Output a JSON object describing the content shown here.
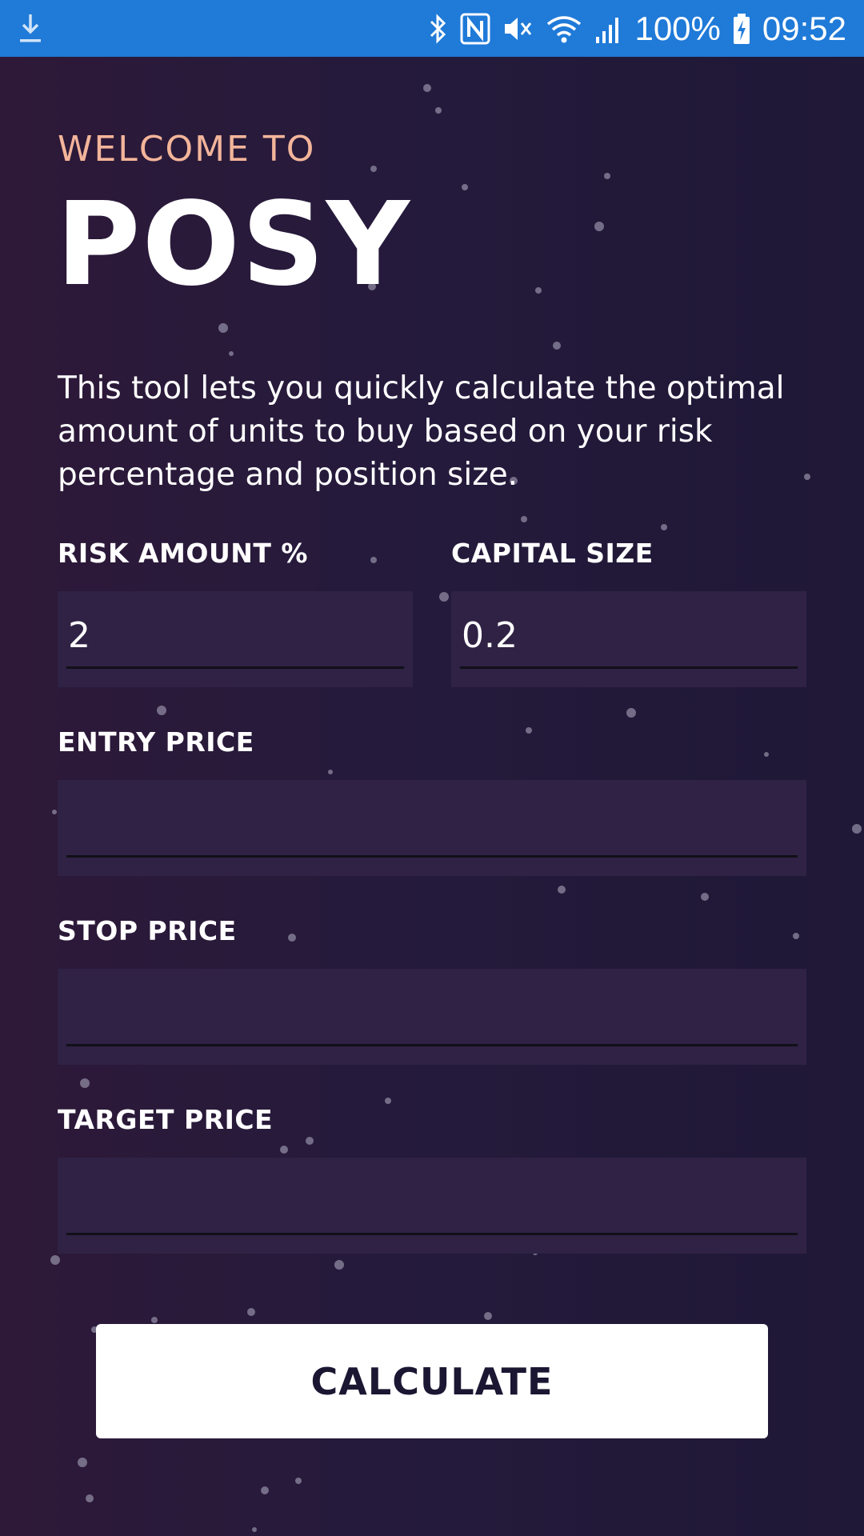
{
  "status_bar": {
    "battery": "100%",
    "time": "09:52",
    "icons": [
      "download-icon",
      "bluetooth-icon",
      "nfc-icon",
      "mute-icon",
      "wifi-icon",
      "signal-icon",
      "battery-charging-icon"
    ]
  },
  "header": {
    "welcome": "WELCOME TO",
    "title": "POSY",
    "description": "This tool lets you quickly calculate the optimal amount of units to buy based on your risk percentage and position size."
  },
  "form": {
    "risk_label": "RISK AMOUNT %",
    "risk_value": "2",
    "capital_label": "CAPITAL SIZE",
    "capital_value": "0.2",
    "entry_label": "ENTRY PRICE",
    "entry_value": "",
    "stop_label": "STOP PRICE",
    "stop_value": "",
    "target_label": "TARGET PRICE",
    "target_value": ""
  },
  "actions": {
    "calculate_label": "CALCULATE"
  },
  "colors": {
    "status_bar": "#1f7ad8",
    "background": "#231a3a",
    "accent": "#f3b59a",
    "field": "#2f2244"
  }
}
